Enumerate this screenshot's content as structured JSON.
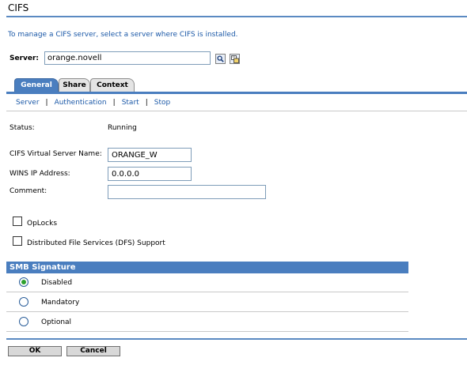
{
  "page": {
    "title": "CIFS",
    "intro": "To manage a CIFS server, select a server where CIFS is installed."
  },
  "server": {
    "label": "Server:",
    "value": "orange.novell",
    "search_icon": "magnifier-icon",
    "browse_icon": "object-browser-icon"
  },
  "tabs": [
    {
      "label": "General",
      "active": true
    },
    {
      "label": "Share",
      "active": false
    },
    {
      "label": "Context",
      "active": false
    }
  ],
  "subnav": [
    {
      "label": "Server"
    },
    {
      "label": "Authentication"
    },
    {
      "label": "Start"
    },
    {
      "label": "Stop"
    }
  ],
  "form": {
    "status_label": "Status:",
    "status_value": "Running",
    "virtual_name_label": "CIFS Virtual Server Name:",
    "virtual_name_value": "ORANGE_W",
    "wins_label": "WINS IP Address:",
    "wins_value": "0.0.0.0",
    "comment_label": "Comment:",
    "comment_value": "",
    "oplocks_label": "OpLocks",
    "oplocks_checked": false,
    "dfs_label": "Distributed File Services (DFS) Support",
    "dfs_checked": false
  },
  "smb": {
    "header": "SMB Signature",
    "options": [
      {
        "label": "Disabled",
        "selected": true
      },
      {
        "label": "Mandatory",
        "selected": false
      },
      {
        "label": "Optional",
        "selected": false
      }
    ]
  },
  "buttons": {
    "ok": "OK",
    "cancel": "Cancel"
  },
  "colors": {
    "accent": "#4a7ebf",
    "link": "#1d5aa8",
    "radio_selected": "#2ea12e"
  }
}
